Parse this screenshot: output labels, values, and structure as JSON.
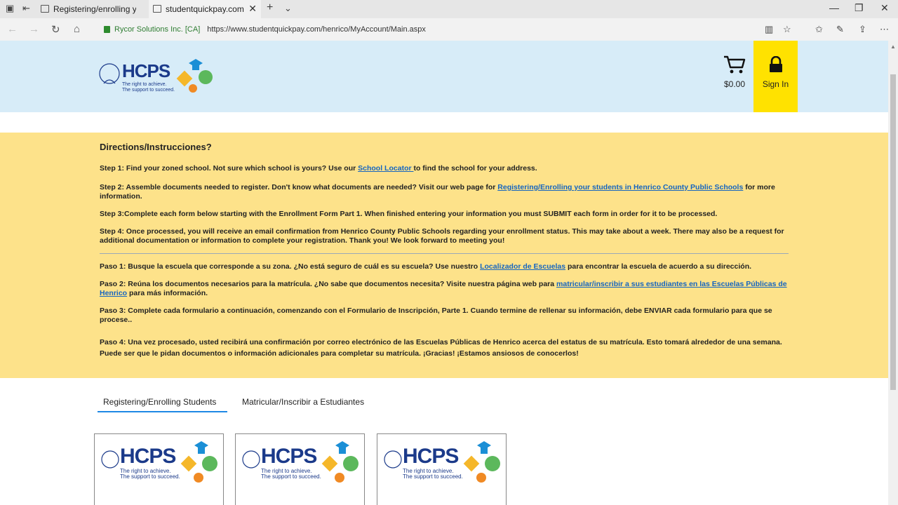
{
  "browser": {
    "tabs": [
      {
        "title": "Registering/enrolling your s",
        "active": false
      },
      {
        "title": "studentquickpay.com",
        "active": true
      }
    ],
    "site_identity": "Rycor Solutions Inc. [CA]",
    "url": "https://www.studentquickpay.com/henrico/MyAccount/Main.aspx"
  },
  "header": {
    "logo_text": "HCPS",
    "logo_tagline_1": "The right to achieve.",
    "logo_tagline_2": "The support to succeed.",
    "cart_amount": "$0.00",
    "signin_label": "Sign In"
  },
  "directions": {
    "heading": "Directions/Instrucciones?",
    "step1_pre": "Step 1: Find your zoned school. Not sure which school is yours? Use our ",
    "step1_link": "School Locator ",
    "step1_post": " to find the school for your address.",
    "step2_pre": "Step 2: Assemble documents needed to register. Don't know what documents are needed? Visit our web page for ",
    "step2_link": "Registering/Enrolling your students in Henrico County Public Schools",
    "step2_post": " for more information.",
    "step3": "Step 3:Complete each form below starting with the Enrollment Form Part 1.  When finished entering your information you must SUBMIT each form in order for it to be processed.",
    "step4": "Step 4: Once processed, you will receive an email confirmation from Henrico County Public Schools regarding your enrollment status. This may take about a week. There may also be a request for additional documentation or information to complete your registration. Thank you! We look forward to meeting you!",
    "paso1_pre": "Paso 1: Busque la escuela que corresponde a su zona.  ¿No está seguro de cuál es su escuela? Use nuestro ",
    "paso1_link": "Localizador de Escuelas",
    "paso1_post": " para encontrar la escuela de acuerdo a su dirección.",
    "paso2_pre": "Paso 2: Reúna los documentos necesarios para la matrícula.  ¿No sabe que documentos necesita? Visite nuestra página web para ",
    "paso2_link": "matricular/inscribir a sus estudiantes en las Escuelas Públicas de Henrico",
    "paso2_post": " para más información.",
    "paso3": "Paso 3: Complete cada formulario a continuación, comenzando con el Formulario de Inscripción, Parte 1. Cuando termine de rellenar su información, debe ENVIAR cada formulario para que se procese..",
    "paso4": "Paso 4: Una vez procesado, usted recibirá una confirmación por correo electrónico de las Escuelas Públicas de Henrico acerca del estatus de su matrícula.  Esto tomará alrededor de una semana.  Puede ser que le pidan documentos o información adicionales para completar su matrícula. ¡Gracias! ¡Estamos ansiosos de conocerlos!"
  },
  "page_tabs": [
    {
      "label": "Registering/Enrolling Students",
      "active": true
    },
    {
      "label": "Matricular/Inscribir a Estudiantes",
      "active": false
    }
  ],
  "cards": [
    {
      "logo_text": "HCPS",
      "tagline_1": "The right to achieve.",
      "tagline_2": "The support to succeed."
    },
    {
      "logo_text": "HCPS",
      "tagline_1": "The right to achieve.",
      "tagline_2": "The support to succeed."
    },
    {
      "logo_text": "HCPS",
      "tagline_1": "The right to achieve.",
      "tagline_2": "The support to succeed."
    }
  ],
  "colors": {
    "header_bg": "#d7ecf8",
    "directions_bg": "#fde28a",
    "signin_bg": "#ffe200",
    "link": "#1565c0",
    "logo_blue": "#1b3a8a"
  }
}
